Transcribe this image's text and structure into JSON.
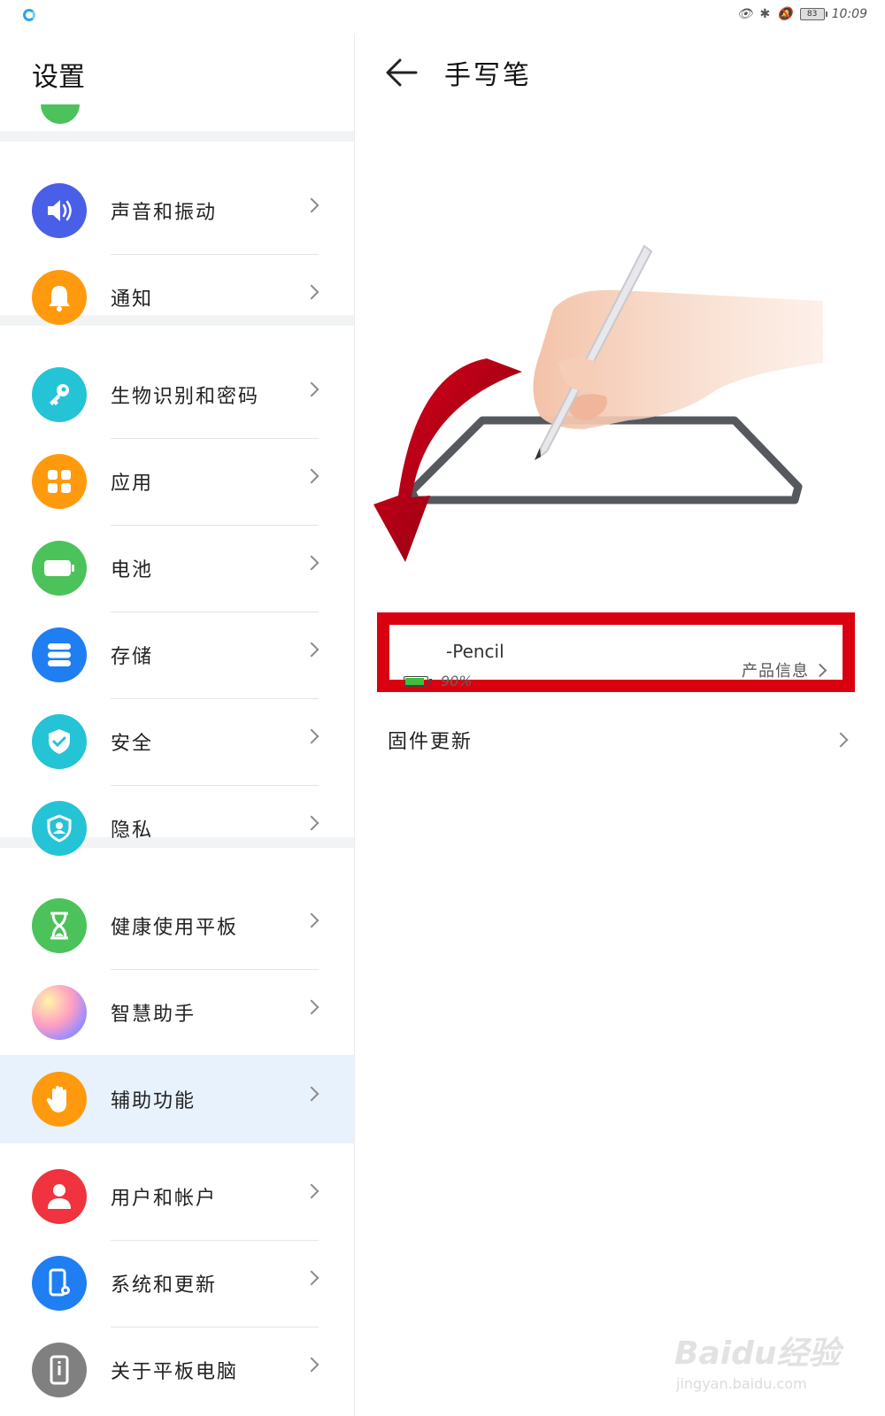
{
  "status_bar": {
    "time": "10:09",
    "battery": "83"
  },
  "sidebar": {
    "title": "设置",
    "items": [
      {
        "label": "声音和振动",
        "icon": "speaker-icon",
        "color": "#4a5fe8"
      },
      {
        "label": "通知",
        "icon": "bell-icon",
        "color": "#ff9a0e"
      },
      {
        "label": "生物识别和密码",
        "icon": "key-icon",
        "color": "#25c3d6"
      },
      {
        "label": "应用",
        "icon": "apps-grid-icon",
        "color": "#ff9a0e"
      },
      {
        "label": "电池",
        "icon": "battery-icon",
        "color": "#4cc25a"
      },
      {
        "label": "存储",
        "icon": "storage-icon",
        "color": "#1f7ff2"
      },
      {
        "label": "安全",
        "icon": "shield-check-icon",
        "color": "#25c3d6"
      },
      {
        "label": "隐私",
        "icon": "privacy-shield-icon",
        "color": "#25c3d6"
      },
      {
        "label": "健康使用平板",
        "icon": "hourglass-icon",
        "color": "#4cc25a"
      },
      {
        "label": "智慧助手",
        "icon": "assistant-orb-icon",
        "color": "#c27df0"
      },
      {
        "label": "辅助功能",
        "icon": "hand-icon",
        "color": "#ff9a0e",
        "selected": true
      },
      {
        "label": "用户和帐户",
        "icon": "user-icon",
        "color": "#f0333e"
      },
      {
        "label": "系统和更新",
        "icon": "system-phone-icon",
        "color": "#1f7ff2"
      },
      {
        "label": "关于平板电脑",
        "icon": "info-phone-icon",
        "color": "#808080"
      }
    ]
  },
  "detail": {
    "title": "手写笔",
    "pencil": {
      "name": "-Pencil",
      "battery_percent": "90%",
      "battery_level": 0.9,
      "product_info": "产品信息"
    },
    "firmware_update": "固件更新"
  },
  "watermark": {
    "brand": "Baidu经验",
    "url": "jingyan.baidu.com"
  },
  "colors": {
    "highlight_box": "#d90010",
    "arrow": "#cc0010",
    "selected_row": "#e8f2fd"
  }
}
